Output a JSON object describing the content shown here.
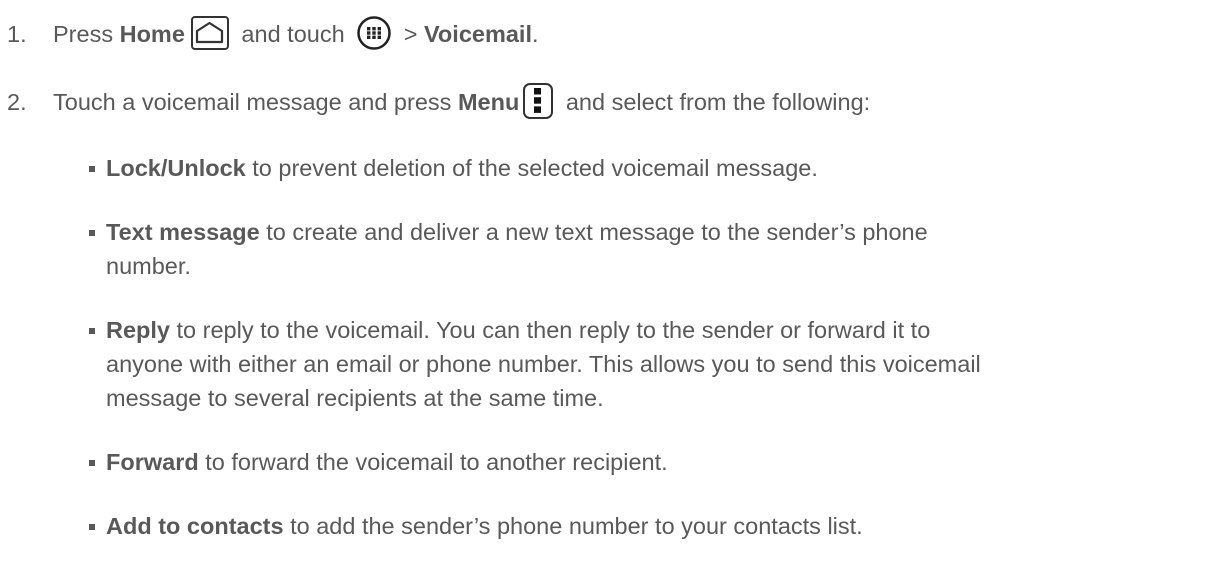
{
  "steps": [
    {
      "number": "1.",
      "text_a": "Press ",
      "bold_home": "Home",
      "text_b": " and touch ",
      "text_c": " > ",
      "bold_voicemail": "Voicemail",
      "text_d": "."
    },
    {
      "number": "2.",
      "text_a": "Touch a voicemail message and press ",
      "bold_menu": "Menu",
      "text_b": " and select from the following:"
    }
  ],
  "icons": {
    "home": "home-icon",
    "apps": "apps-icon",
    "menu": "menu-icon"
  },
  "options": [
    {
      "label": "Lock/Unlock",
      "desc": " to prevent deletion of the selected voicemail message."
    },
    {
      "label": "Text message",
      "desc": " to create and deliver a new text message to the sender’s phone",
      "desc2": "number."
    },
    {
      "label": "Reply",
      "desc": " to reply to the voicemail. You can then reply to the sender or forward it to",
      "desc2": "anyone with either an email or phone number. This allows you to send this voicemail",
      "desc3": "message to several recipients at the same time."
    },
    {
      "label": "Forward",
      "desc": " to forward the voicemail to another recipient."
    },
    {
      "label": "Add to contacts",
      "desc": " to add the sender’s phone number to your contacts list."
    }
  ]
}
